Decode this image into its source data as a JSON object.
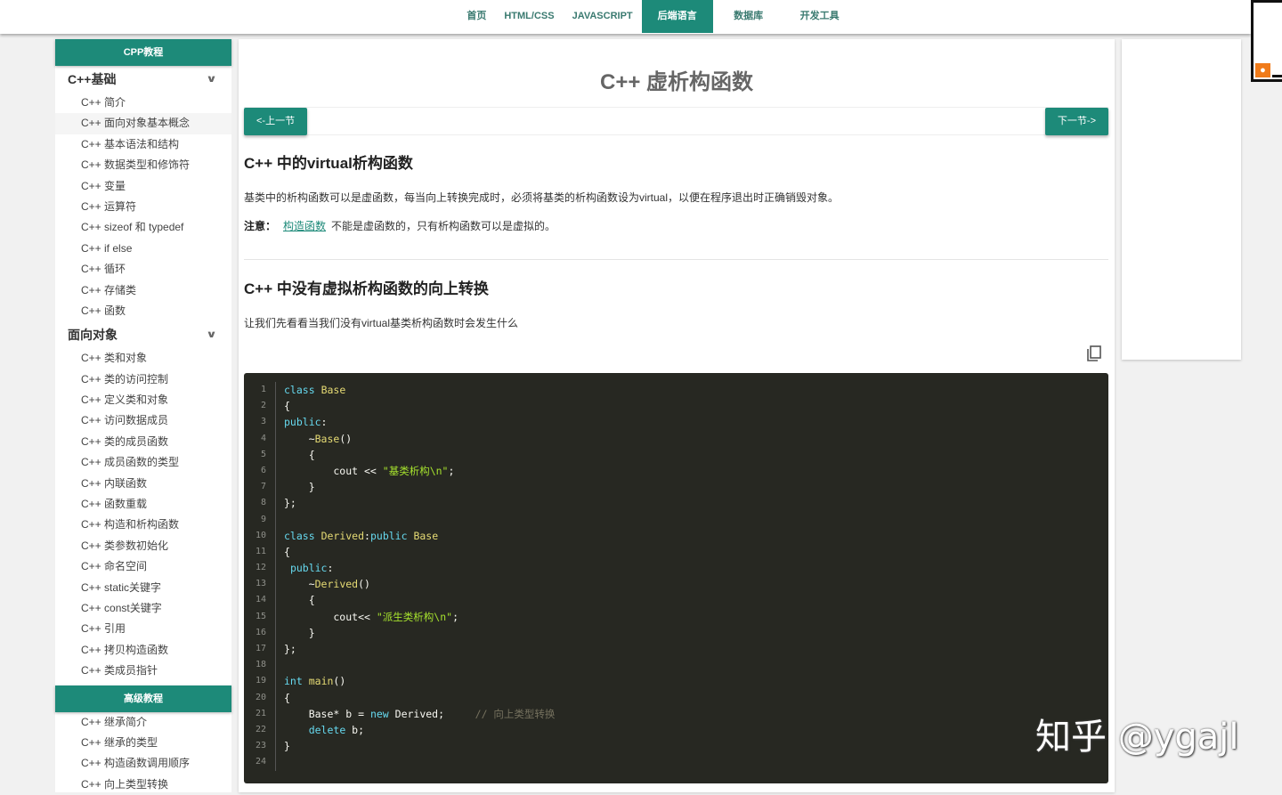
{
  "nav": {
    "items": [
      "首页",
      "HTML/CSS",
      "JAVASCRIPT",
      "后端语言",
      "数据库",
      "开发工具"
    ],
    "active": 3
  },
  "sidebar": {
    "header1": "CPP教程",
    "group1": "C++基础",
    "group1_items": [
      "C++ 简介",
      "C++ 面向对象基本概念",
      "C++ 基本语法和结构",
      "C++ 数据类型和修饰符",
      "C++ 变量",
      "C++ 运算符",
      "C++ sizeof 和 typedef",
      "C++ if else",
      "C++ 循环",
      "C++ 存储类",
      "C++ 函数"
    ],
    "group2": "面向对象",
    "group2_items": [
      "C++ 类和对象",
      "C++ 类的访问控制",
      "C++ 定义类和对象",
      "C++ 访问数据成员",
      "C++ 类的成员函数",
      "C++ 成员函数的类型",
      "C++ 内联函数",
      "C++ 函数重载",
      "C++ 构造和析构函数",
      "C++ 类参数初始化",
      "C++ 命名空间",
      "C++ static关键字",
      "C++ const关键字",
      "C++ 引用",
      "C++ 拷贝构造函数",
      "C++ 类成员指针"
    ],
    "header2": "高级教程",
    "group3_items": [
      "C++ 继承简介",
      "C++ 继承的类型",
      "C++ 构造函数调用顺序",
      "C++ 向上类型转换"
    ]
  },
  "main": {
    "title": "C++ 虚析构函数",
    "prev": "<-上一节",
    "next": "下一节->",
    "h2_1": "C++ 中的virtual析构函数",
    "p1": "基类中的析构函数可以是虚函数，每当向上转换完成时，必须将基类的析构函数设为virtual，以便在程序退出时正确销毁对象。",
    "note_label": "注意：",
    "note_link": "构造函数",
    "note_text": "不能是虚函数的，只有析构函数可以是虚拟的。",
    "h2_2": "C++ 中没有虚拟析构函数的向上转换",
    "p2": "让我们先看看当我们没有virtual基类析构函数时会发生什么"
  },
  "code": [
    [
      [
        "k",
        "class"
      ],
      [
        "",
        " "
      ],
      [
        "f",
        "Base"
      ]
    ],
    [
      [
        "",
        "{"
      ]
    ],
    [
      [
        "k",
        "public"
      ],
      [
        "",
        ":"
      ]
    ],
    [
      [
        "",
        "    ~"
      ],
      [
        "f",
        "Base"
      ],
      [
        "",
        "()"
      ]
    ],
    [
      [
        "",
        "    {"
      ]
    ],
    [
      [
        "",
        "        cout << "
      ],
      [
        "s",
        "\"基类析构\\n\""
      ],
      [
        "",
        ";"
      ]
    ],
    [
      [
        "",
        "    }"
      ]
    ],
    [
      [
        "",
        "};"
      ]
    ],
    [],
    [
      [
        "k",
        "class"
      ],
      [
        "",
        " "
      ],
      [
        "f",
        "Derived"
      ],
      [
        "",
        ":"
      ],
      [
        "k",
        "public"
      ],
      [
        "",
        " "
      ],
      [
        "f",
        "Base"
      ]
    ],
    [
      [
        "",
        "{"
      ]
    ],
    [
      [
        "",
        " "
      ],
      [
        "k",
        "public"
      ],
      [
        "",
        ":"
      ]
    ],
    [
      [
        "",
        "    ~"
      ],
      [
        "f",
        "Derived"
      ],
      [
        "",
        "()"
      ]
    ],
    [
      [
        "",
        "    {"
      ]
    ],
    [
      [
        "",
        "        cout<< "
      ],
      [
        "s",
        "\"派生类析构\\n\""
      ],
      [
        "",
        ";"
      ]
    ],
    [
      [
        "",
        "    }"
      ]
    ],
    [
      [
        "",
        "};"
      ]
    ],
    [],
    [
      [
        "k",
        "int"
      ],
      [
        "",
        " "
      ],
      [
        "f",
        "main"
      ],
      [
        "",
        "()"
      ]
    ],
    [
      [
        "",
        "{"
      ]
    ],
    [
      [
        "",
        "    Base* b = "
      ],
      [
        "k",
        "new"
      ],
      [
        "",
        " Derived;     "
      ],
      [
        "cm",
        "// 向上类型转换"
      ]
    ],
    [
      [
        "",
        "    "
      ],
      [
        "k",
        "delete"
      ],
      [
        "",
        " b;"
      ]
    ],
    [
      [
        "",
        "}"
      ]
    ],
    []
  ],
  "watermark": "知乎 @ygajl"
}
